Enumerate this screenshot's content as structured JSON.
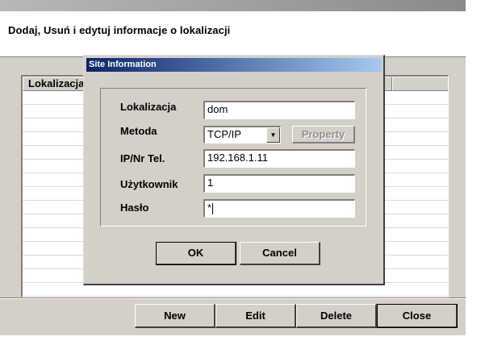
{
  "page": {
    "heading": "Dodaj, Usuń i edytuj informacje o lokalizacji"
  },
  "list": {
    "column_header": "Lokalizacja",
    "rows": []
  },
  "buttons": {
    "new": "New",
    "edit": "Edit",
    "delete": "Delete",
    "close": "Close"
  },
  "dialog": {
    "title": "Site Information",
    "fields": {
      "location_label": "Lokalizacja",
      "location_value": "dom",
      "method_label": "Metoda",
      "method_value": "TCP/IP",
      "property_label": "Property",
      "ip_label": "IP/Nr Tel.",
      "ip_value": "192.168.1.11",
      "user_label": "Użytkownik",
      "user_value": "1",
      "password_label": "Hasło",
      "password_value": "*"
    },
    "ok_label": "OK",
    "cancel_label": "Cancel"
  },
  "colors": {
    "face": "#d4d0c8",
    "title_start": "#0a246a",
    "title_end": "#a6caf0"
  },
  "icons": {
    "dropdown": "triangle-down-icon"
  }
}
